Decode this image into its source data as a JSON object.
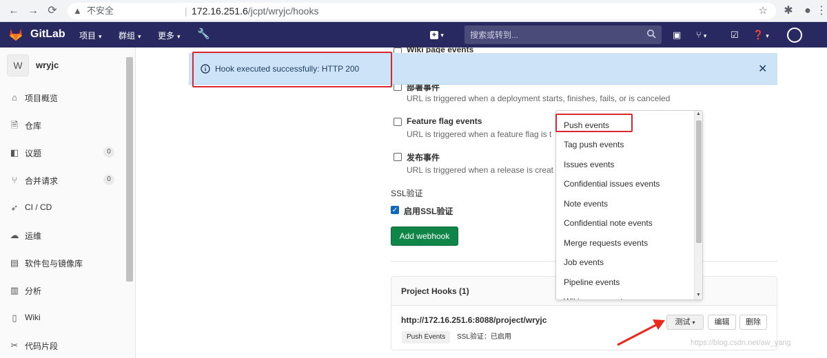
{
  "browser": {
    "insecure_label": "不安全",
    "url_host": "172.16.251.6",
    "url_path": "/jcpt/wryjc/hooks"
  },
  "topbar": {
    "brand": "GitLab",
    "menu_projects": "项目",
    "menu_groups": "群组",
    "menu_more": "更多",
    "search_placeholder": "搜索或转到..."
  },
  "sidebar": {
    "project_initial": "W",
    "project_name": "wryjc",
    "items": [
      {
        "label": "项目概览",
        "icon": "home-icon"
      },
      {
        "label": "仓库",
        "icon": "document-icon"
      },
      {
        "label": "议题",
        "icon": "issues-icon",
        "count": "0"
      },
      {
        "label": "合并请求",
        "icon": "merge-request-icon",
        "count": "0"
      },
      {
        "label": "CI / CD",
        "icon": "rocket-icon"
      },
      {
        "label": "运维",
        "icon": "cloud-icon"
      },
      {
        "label": "软件包与镜像库",
        "icon": "package-icon"
      },
      {
        "label": "分析",
        "icon": "chart-icon"
      },
      {
        "label": "Wiki",
        "icon": "book-icon"
      },
      {
        "label": "代码片段",
        "icon": "snippet-icon"
      }
    ]
  },
  "flash": {
    "message": "Hook executed successfully: HTTP 200"
  },
  "events": {
    "wiki_title": "Wiki page events",
    "deploy_title": "部署事件",
    "deploy_desc": "URL is triggered when a deployment starts, finishes, fails, or is canceled",
    "feature_title": "Feature flag events",
    "feature_desc": "URL is triggered when a feature flag is t",
    "release_title": "发布事件",
    "release_desc": "URL is triggered when a release is creat"
  },
  "ssl": {
    "heading": "SSL验证",
    "label": "启用SSL验证",
    "checked": true
  },
  "add_webhook_label": "Add webhook",
  "hooks": {
    "title": "Project Hooks (1)",
    "url": "http://172.16.251.6:8088/project/wryjc",
    "tag_event": "Push Events",
    "ssl_label": "SSL验证：已启用",
    "test_label": "测试",
    "edit_label": "编辑",
    "delete_label": "删除"
  },
  "test_dropdown": {
    "options": [
      "Push events",
      "Tag push events",
      "Issues events",
      "Confidential issues events",
      "Note events",
      "Confidential note events",
      "Merge requests events",
      "Job events",
      "Pipeline events",
      "Wiki page events"
    ]
  },
  "watermark": "https://blog.csdn.net/aw_yang",
  "colors": {
    "navbar": "#292961",
    "flash_bg": "#cde4f8",
    "primary_button": "#108548",
    "highlight_box": "#d9262f",
    "annotation_arrow": "#e8291c"
  }
}
